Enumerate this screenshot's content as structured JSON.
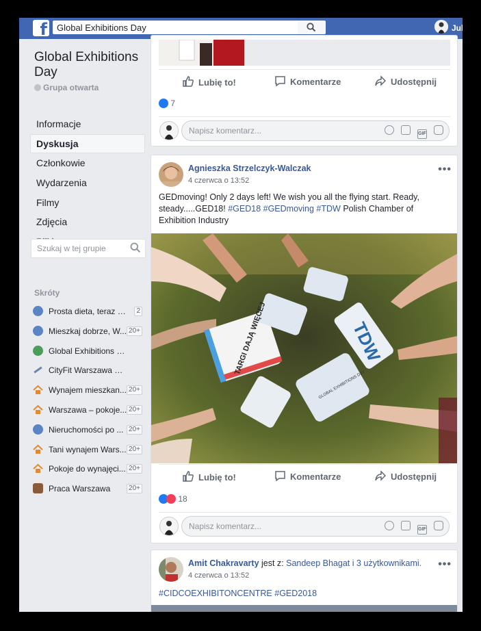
{
  "topbar": {
    "search_value": "Global Exhibitions Day",
    "user_name": "Jul"
  },
  "sidebar": {
    "group_name": "Global Exhibitions Day",
    "group_type": "Grupa otwarta",
    "nav": [
      {
        "label": "Informacje"
      },
      {
        "label": "Dyskusja",
        "active": true
      },
      {
        "label": "Członkowie"
      },
      {
        "label": "Wydarzenia"
      },
      {
        "label": "Filmy"
      },
      {
        "label": "Zdjęcia"
      },
      {
        "label": "Pliki"
      }
    ],
    "search_placeholder": "Szukaj w tej grupie",
    "shortcuts_title": "Skróty",
    "shortcuts": [
      {
        "label": "Prosta dieta, teraz ni...",
        "badge": "2",
        "icon": "group-icon"
      },
      {
        "label": "Mieszkaj dobrze, W...",
        "badge": "20+",
        "icon": "group-icon"
      },
      {
        "label": "Global Exhibitions Day",
        "badge": "",
        "icon": "globe-icon"
      },
      {
        "label": "CityFit Warszawa Wiatr...",
        "badge": "",
        "icon": "dumbbell-icon"
      },
      {
        "label": "Wynajem mieszkan...",
        "badge": "20+",
        "icon": "house-icon"
      },
      {
        "label": "Warszawa – pokoje...",
        "badge": "20+",
        "icon": "house-icon"
      },
      {
        "label": "Nieruchomości po ...",
        "badge": "20+",
        "icon": "group-icon"
      },
      {
        "label": "Tani wynajem Wars...",
        "badge": "20+",
        "icon": "house-icon"
      },
      {
        "label": "Pokoje do wynajęci...",
        "badge": "20+",
        "icon": "house-icon"
      },
      {
        "label": "Praca Warszawa",
        "badge": "20+",
        "icon": "briefcase-icon"
      }
    ]
  },
  "actions": {
    "like": "Lubię to!",
    "comment": "Komentarze",
    "share": "Udostępnij"
  },
  "comment_placeholder": "Napisz komentarz...",
  "post0": {
    "reactions_count": "7"
  },
  "post1": {
    "author": "Agnieszka Strzelczyk-Walczak",
    "time": "4 czerwca o 13:52",
    "text_part1": "GEDmoving! Only 2 days left! We wish you all the flying start. Ready, steady.....GED18! ",
    "tags": "#GED18 #GEDmoving #TDW",
    "text_part2": " Polish Chamber of Exhibition Industry",
    "image_signs": {
      "sign1": "TARGI DAJĄ WIĘCEJ",
      "sign2": "TDW",
      "sign3": "GLOBAL EXHIBITIONS DAY"
    },
    "reactions_count": "18"
  },
  "post2": {
    "author": "Amit Chakravarty",
    "with_text": " jest z: ",
    "with_people": "Sandeep Bhagat i 3 użytkownikami.",
    "time": "4 czerwca o 13:52",
    "tags": "#CIDCOEXHIBITONCENTRE #GED2018"
  },
  "colors": {
    "brand_blue": "#4267b2",
    "link_blue": "#385898",
    "like_blue": "#2078f4",
    "love_red": "#f33e58"
  }
}
